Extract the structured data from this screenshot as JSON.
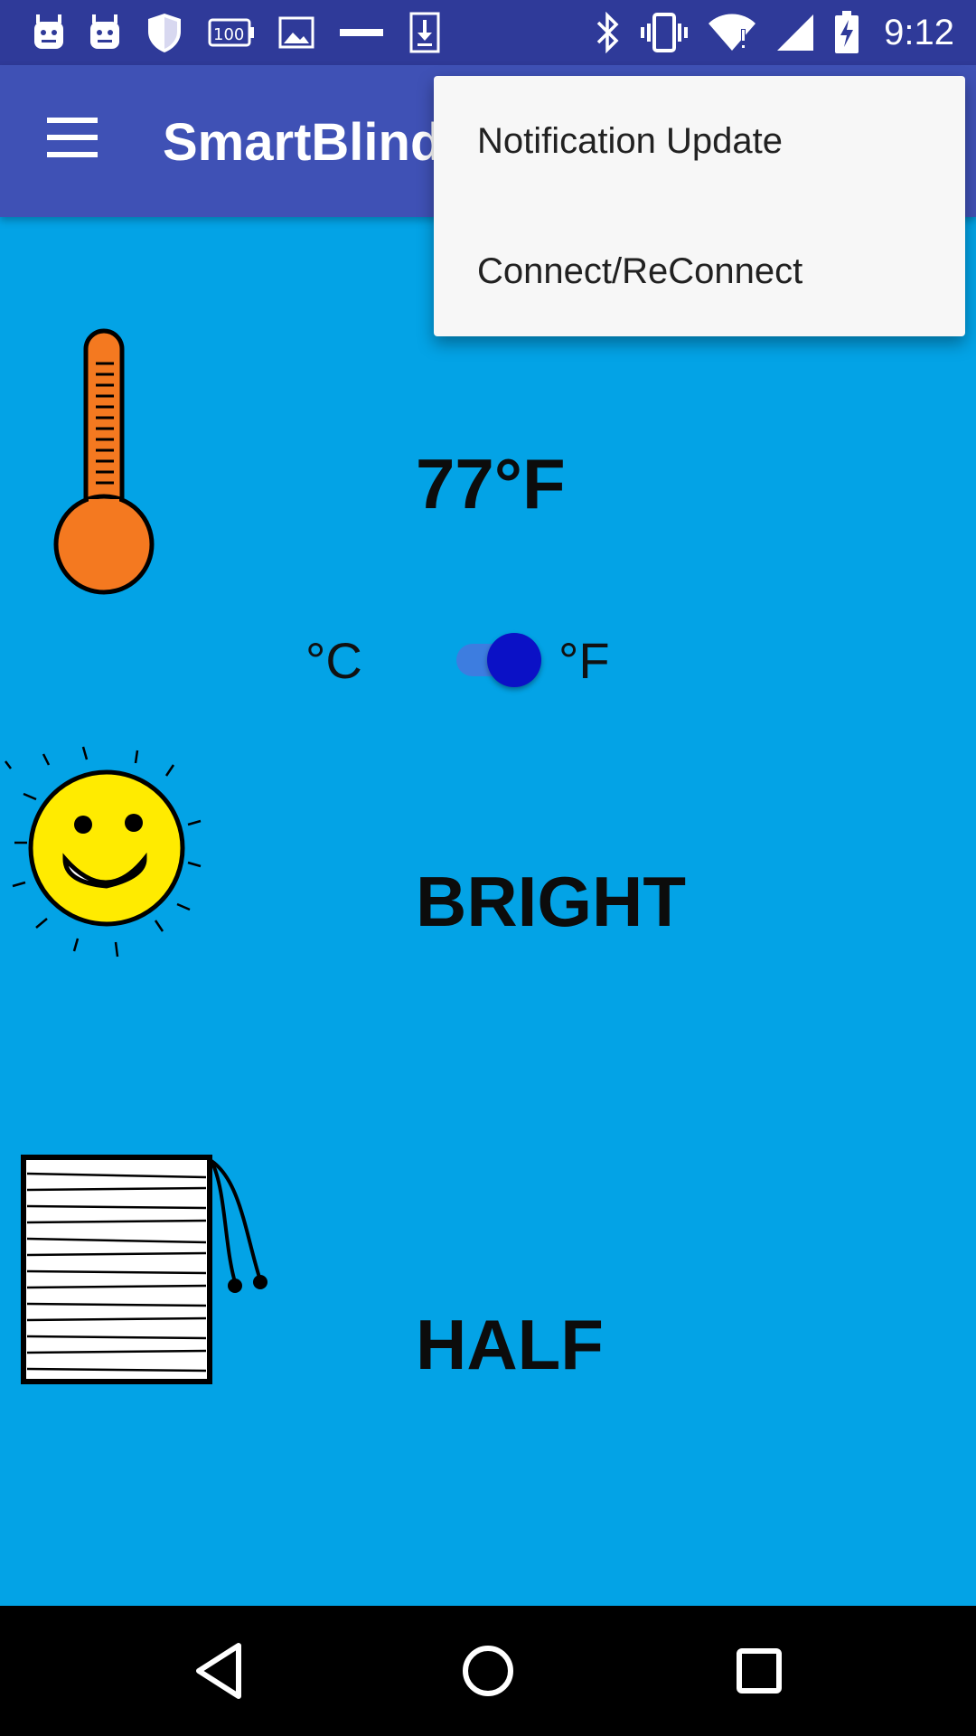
{
  "status_bar": {
    "time": "9:12",
    "left_icons": [
      "android-icon",
      "android-icon",
      "shield-icon",
      "battery-100-icon",
      "image-icon",
      "minus-icon",
      "download-icon"
    ],
    "right_icons": [
      "bluetooth-icon",
      "vibrate-icon",
      "wifi-icon",
      "signal-icon",
      "battery-charging-icon"
    ]
  },
  "app_bar": {
    "title": "SmartBlinds"
  },
  "overflow_menu": {
    "items": [
      "Notification Update",
      "Connect/ReConnect"
    ]
  },
  "temperature": {
    "value": "77°F",
    "unit_celsius": "°C",
    "unit_fahrenheit": "°F",
    "unit_toggle_on": true,
    "icon": "thermometer-icon"
  },
  "light": {
    "value": "BRIGHT",
    "icon": "smiling-sun-icon"
  },
  "blinds": {
    "value": "HALF",
    "icon": "window-blinds-icon"
  },
  "colors": {
    "status_bar": "#2F3A99",
    "app_bar": "#3F51B5",
    "background": "#03A3E6",
    "toggle_thumb": "#0B11C6",
    "toggle_track": "#3D7DE0",
    "thermometer": "#F47920",
    "sun": "#FFEB00"
  },
  "nav_bar": {
    "buttons": [
      "back-icon",
      "home-icon",
      "recents-icon"
    ]
  }
}
